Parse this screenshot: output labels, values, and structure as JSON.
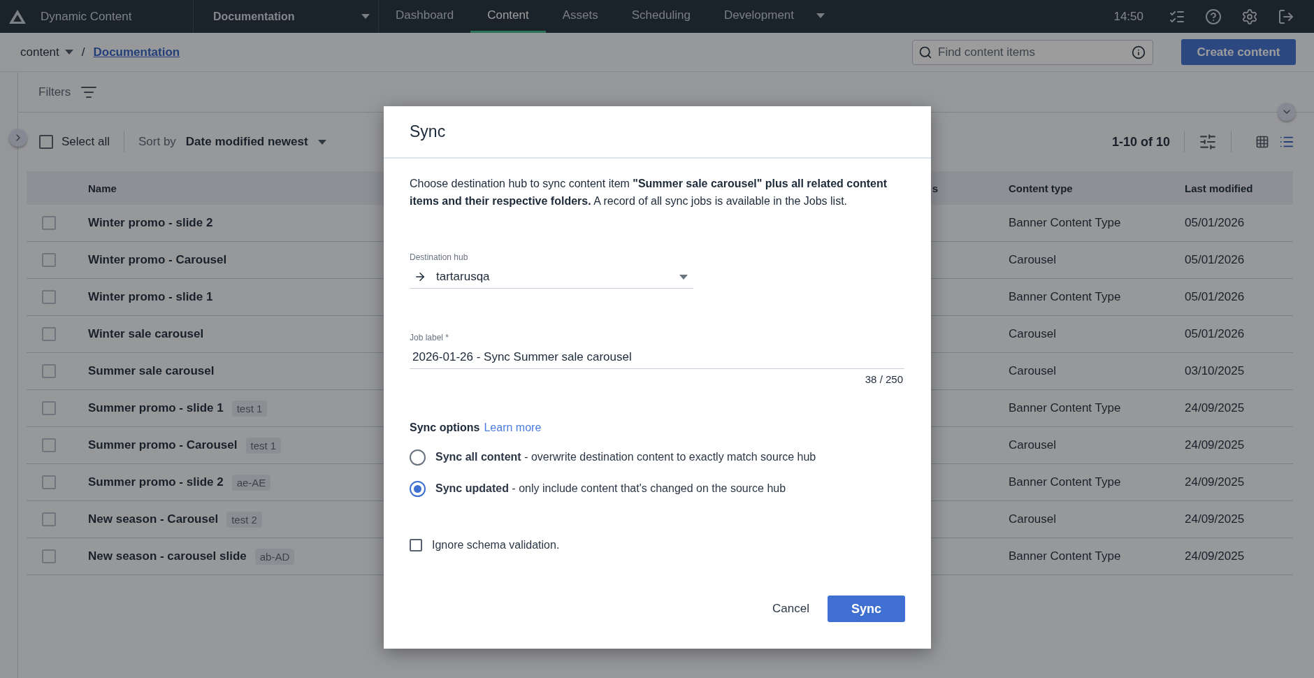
{
  "app": {
    "name": "Dynamic Content"
  },
  "hub_selector": {
    "label": "Documentation"
  },
  "nav_tabs": [
    {
      "label": "Dashboard",
      "selected": false
    },
    {
      "label": "Content",
      "selected": true
    },
    {
      "label": "Assets",
      "selected": false
    },
    {
      "label": "Scheduling",
      "selected": false
    },
    {
      "label": "Development",
      "selected": false,
      "has_menu": true
    }
  ],
  "clock": "14:50",
  "breadcrumb": {
    "root": "content",
    "separator": "/",
    "current": "Documentation"
  },
  "search": {
    "placeholder": "Find content items"
  },
  "create_button": "Create content",
  "filters": {
    "label": "Filters"
  },
  "toolbar": {
    "select_all": {
      "label": "Select all",
      "checked": false
    },
    "sort_label": "Sort by",
    "sort_value": "Date modified newest",
    "range": "1-10 of 10",
    "views": [
      {
        "kind": "grid",
        "selected": false
      },
      {
        "kind": "list",
        "selected": true
      }
    ]
  },
  "table": {
    "columns": [
      "Name",
      "s",
      "Content type",
      "Last modified"
    ],
    "rows": [
      {
        "name": "Winter promo - slide 2",
        "content_type": "Banner Content Type",
        "last_modified": "05/01/2026",
        "checked": false
      },
      {
        "name": "Winter promo - Carousel",
        "content_type": "Carousel",
        "last_modified": "05/01/2026",
        "checked": false
      },
      {
        "name": "Winter promo - slide 1",
        "content_type": "Banner Content Type",
        "last_modified": "05/01/2026",
        "checked": false
      },
      {
        "name": "Winter sale carousel",
        "content_type": "Carousel",
        "last_modified": "05/01/2026",
        "checked": false
      },
      {
        "name": "Summer sale carousel",
        "content_type": "Carousel",
        "last_modified": "03/10/2025",
        "checked": false
      },
      {
        "name": "Summer promo - slide 1",
        "tag": "test 1",
        "content_type": "Banner Content Type",
        "last_modified": "24/09/2025",
        "checked": false
      },
      {
        "name": "Summer promo - Carousel",
        "tag": "test 1",
        "content_type": "Carousel",
        "last_modified": "24/09/2025",
        "checked": false
      },
      {
        "name": "Summer promo - slide 2",
        "tag": "ae-AE",
        "content_type": "Banner Content Type",
        "last_modified": "24/09/2025",
        "checked": false
      },
      {
        "name": "New season - Carousel",
        "tag": "test 2",
        "content_type": "Carousel",
        "last_modified": "24/09/2025",
        "checked": false
      },
      {
        "name": "New season - carousel slide",
        "tag": "ab-AD",
        "content_type": "Banner Content Type",
        "last_modified": "24/09/2025",
        "checked": false
      }
    ]
  },
  "dialog": {
    "title": "Sync",
    "description": "Choose destination hub to sync content item **\"Summer sale carousel\" plus all related content items and their respective folders.** A record of all sync jobs is available in the Jobs list.",
    "destination": {
      "label": "Destination hub",
      "value": "tartarusqa"
    },
    "job_label": {
      "label": "Job label *",
      "value": "2026-01-26 - Sync Summer sale carousel",
      "counter": "38 / 250"
    },
    "sync_options": {
      "title": "Sync options",
      "link": "Learn more",
      "options": [
        {
          "label": "**Sync all content** - overwrite destination content to exactly match source hub",
          "selected": false
        },
        {
          "label": "**Sync updated** - only include content that's changed on the source hub",
          "selected": true
        }
      ]
    },
    "ignore_schema": {
      "label": "Ignore schema validation.",
      "checked": false
    },
    "cancel": "Cancel",
    "confirm": "Sync"
  }
}
